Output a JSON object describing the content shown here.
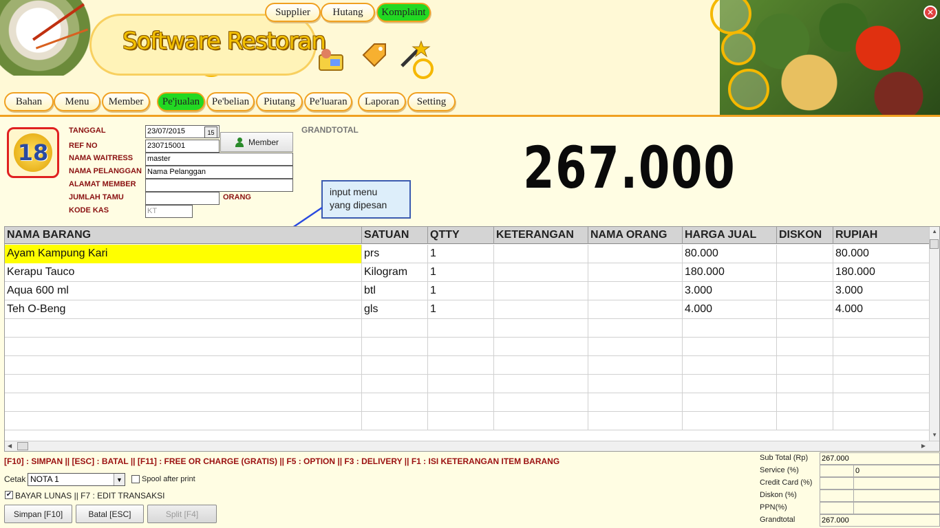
{
  "app": {
    "title": "Software Restoran",
    "close_icon": "close-icon"
  },
  "top_nav": [
    {
      "label": "Supplier",
      "active": false
    },
    {
      "label": "Hutang",
      "active": false
    },
    {
      "label": "Komplaint",
      "active": true
    }
  ],
  "main_nav": [
    {
      "label": "Bahan",
      "active": false
    },
    {
      "label": "Menu",
      "active": false
    },
    {
      "label": "Member",
      "active": false
    },
    {
      "label": "Pe'jualan",
      "active": true
    },
    {
      "label": "Pe'belian",
      "active": false
    },
    {
      "label": "Piutang",
      "active": false
    },
    {
      "label": "Pe'luaran",
      "active": false
    },
    {
      "label": "Laporan",
      "active": false
    },
    {
      "label": "Setting",
      "active": false
    }
  ],
  "table_badge": "18",
  "form": {
    "tanggal_label": "TANGGAL",
    "tanggal_value": "23/07/2015",
    "date_icon": "15",
    "ref_label": "REF NO",
    "ref_value": "230715001",
    "waitress_label": "NAMA WAITRESS",
    "waitress_value": "master",
    "pelanggan_label": "NAMA PELANGGAN",
    "pelanggan_value": "Nama Pelanggan",
    "alamat_label": "ALAMAT MEMBER",
    "alamat_value": "",
    "tamu_label": "JUMLAH TAMU",
    "tamu_value": "",
    "orang_label": "ORANG",
    "kas_label": "KODE KAS",
    "kas_value": "KT",
    "member_button": "Member"
  },
  "grandtotal": {
    "label": "GRANDTOTAL",
    "value": "267.000"
  },
  "callout": {
    "line1": "input menu",
    "line2": "yang dipesan"
  },
  "grid": {
    "columns": [
      "NAMA BARANG",
      "SATUAN",
      "QTTY",
      "KETERANGAN",
      "NAMA ORANG",
      "HARGA JUAL",
      "DISKON",
      "RUPIAH"
    ],
    "rows": [
      [
        "Ayam Kampung Kari",
        "prs",
        "1",
        "",
        "",
        "80.000",
        "",
        "80.000"
      ],
      [
        "Kerapu Tauco",
        "Kilogram",
        "1",
        "",
        "",
        "180.000",
        "",
        "180.000"
      ],
      [
        "Aqua 600 ml",
        "btl",
        "1",
        "",
        "",
        "3.000",
        "",
        "3.000"
      ],
      [
        "Teh O-Beng",
        "gls",
        "1",
        "",
        "",
        "4.000",
        "",
        "4.000"
      ]
    ],
    "empty_rows": 6
  },
  "footer": {
    "shortcuts": "[F10] : SIMPAN  ||  [ESC] : BATAL || [F11]  : FREE OR CHARGE (GRATIS) || F5 : OPTION || F3 : DELIVERY || F1 : ISI KETERANGAN ITEM BARANG",
    "cetak_label": "Cetak",
    "cetak_value": "NOTA 1",
    "spool_label": "Spool after print",
    "spool_checked": false,
    "bayar_label": "BAYAR LUNAS || F7 : EDIT TRANSAKSI",
    "bayar_checked": true,
    "buttons": {
      "simpan": "Simpan [F10]",
      "batal": "Batal [ESC]",
      "split": "Split [F4]"
    }
  },
  "totals": {
    "subtotal_label": "Sub Total (Rp)",
    "subtotal_value": "267.000",
    "service_label": "Service (%)",
    "service_pct": "",
    "service_value": "0",
    "cc_label": "Credit Card (%)",
    "cc_pct": "",
    "cc_value": "",
    "diskon_label": "Diskon (%)",
    "diskon_pct": "",
    "diskon_value": "",
    "ppn_label": "PPN(%)",
    "ppn_pct": "",
    "ppn_value": "",
    "grandtotal_label": "Grandtotal",
    "grandtotal_value": "267.000"
  },
  "colors": {
    "accent": "#f0a020",
    "active": "#22d822",
    "label_red": "#8a1010",
    "selected_row": "#ffff00"
  }
}
